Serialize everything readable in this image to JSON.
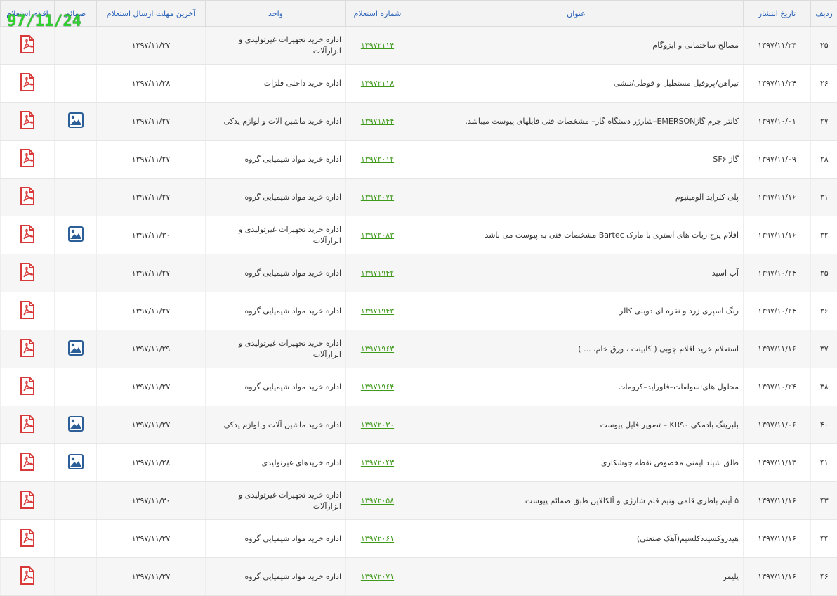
{
  "stamp_text": "97/11/24",
  "headers": {
    "index": "ردیف",
    "publish_date": "تاریخ انتشار",
    "title": "عنوان",
    "inquiry_number": "شماره استعلام",
    "unit": "واحد",
    "deadline": "آخرین مهلت ارسال استعلام",
    "attachments": "ضمائم",
    "inquiry_items": "اقلام استعلام"
  },
  "rows": [
    {
      "index": "۲۵",
      "date": "۱۳۹۷/۱۱/۲۳",
      "title": "مصالح ساختمانی و ایزوگام",
      "number": "۱۳۹۷۲۱۱۴",
      "unit": "اداره خرید تجهیزات غیرتولیدی و ابزارآلات",
      "deadline": "۱۳۹۷/۱۱/۲۷",
      "has_attachment": false
    },
    {
      "index": "۲۶",
      "date": "۱۳۹۷/۱۱/۲۴",
      "title": "تیرآهن/پروفیل مستطیل و قوطی/نبشی",
      "number": "۱۳۹۷۲۱۱۸",
      "unit": "اداره خرید داخلی فلزات",
      "deadline": "۱۳۹۷/۱۱/۲۸",
      "has_attachment": false
    },
    {
      "index": "۲۷",
      "date": "۱۳۹۷/۱۰/۰۱",
      "title": "کانتر جرم گازEMERSON–شارژر دستگاه گاز– مشخصات فنی فایلهای پیوست میباشد.",
      "number": "۱۳۹۷۱۸۴۴",
      "unit": "اداره خرید ماشین آلات و لوازم یدکی",
      "deadline": "۱۳۹۷/۱۱/۲۷",
      "has_attachment": true
    },
    {
      "index": "۲۸",
      "date": "۱۳۹۷/۱۱/۰۹",
      "title": "گاز SF۶",
      "number": "۱۳۹۷۲۰۱۲",
      "unit": "اداره خرید مواد شیمیایی گروه",
      "deadline": "۱۳۹۷/۱۱/۲۷",
      "has_attachment": false
    },
    {
      "index": "۳۱",
      "date": "۱۳۹۷/۱۱/۱۶",
      "title": "پلی کلراید آلومینیوم",
      "number": "۱۳۹۷۲۰۷۲",
      "unit": "اداره خرید مواد شیمیایی گروه",
      "deadline": "۱۳۹۷/۱۱/۲۷",
      "has_attachment": false
    },
    {
      "index": "۳۲",
      "date": "۱۳۹۷/۱۱/۱۶",
      "title": "اقلام یرج ربات های آستری با مارک Bartec مشخصات فنی به پیوست می باشد",
      "number": "۱۳۹۷۲۰۸۳",
      "unit": "اداره خرید تجهیزات غیرتولیدی و ابزارآلات",
      "deadline": "۱۳۹۷/۱۱/۳۰",
      "has_attachment": true
    },
    {
      "index": "۳۵",
      "date": "۱۳۹۷/۱۰/۲۴",
      "title": "آب اسید",
      "number": "۱۳۹۷۱۹۴۲",
      "unit": "اداره خرید مواد شیمیایی گروه",
      "deadline": "۱۳۹۷/۱۱/۲۷",
      "has_attachment": false
    },
    {
      "index": "۳۶",
      "date": "۱۳۹۷/۱۰/۲۴",
      "title": "رنگ اسپری زرد و نقره ای دوبلی کالر",
      "number": "۱۳۹۷۱۹۴۳",
      "unit": "اداره خرید مواد شیمیایی گروه",
      "deadline": "۱۳۹۷/۱۱/۲۷",
      "has_attachment": false
    },
    {
      "index": "۳۷",
      "date": "۱۳۹۷/۱۱/۱۶",
      "title": "استعلام خرید اقلام چوبی ( کابینت ، ورق خام، ... )",
      "number": "۱۳۹۷۱۹۶۳",
      "unit": "اداره خرید تجهیزات غیرتولیدی و ابزارآلات",
      "deadline": "۱۳۹۷/۱۱/۲۹",
      "has_attachment": true
    },
    {
      "index": "۳۸",
      "date": "۱۳۹۷/۱۰/۲۴",
      "title": "محلول های:سولفات–فلوراید–کرومات",
      "number": "۱۳۹۷۱۹۶۴",
      "unit": "اداره خرید مواد شیمیایی گروه",
      "deadline": "۱۳۹۷/۱۱/۲۷",
      "has_attachment": false
    },
    {
      "index": "۴۰",
      "date": "۱۳۹۷/۱۱/۰۶",
      "title": "بلبرینگ بادمکی KR۹۰ – تصویر فایل پیوست",
      "number": "۱۳۹۷۲۰۳۰",
      "unit": "اداره خرید ماشین آلات و لوازم یدکی",
      "deadline": "۱۳۹۷/۱۱/۲۷",
      "has_attachment": true
    },
    {
      "index": "۴۱",
      "date": "۱۳۹۷/۱۱/۱۳",
      "title": "طلق شیلد ایمنی مخصوص نقطه جوشکاری",
      "number": "۱۳۹۷۲۰۴۳",
      "unit": "اداره خریدهای غیرتولیدی",
      "deadline": "۱۳۹۷/۱۱/۲۸",
      "has_attachment": true
    },
    {
      "index": "۴۳",
      "date": "۱۳۹۷/۱۱/۱۶",
      "title": "۵ آیتم باطری قلمی ونیم قلم شارژی و آلکالاین طبق ضمائم پیوست",
      "number": "۱۳۹۷۲۰۵۸",
      "unit": "اداره خرید تجهیزات غیرتولیدی و ابزارآلات",
      "deadline": "۱۳۹۷/۱۱/۳۰",
      "has_attachment": false
    },
    {
      "index": "۴۴",
      "date": "۱۳۹۷/۱۱/۱۶",
      "title": "هیدروکسیددکلسیم(آهک صنعتی)",
      "number": "۱۳۹۷۲۰۶۱",
      "unit": "اداره خرید مواد شیمیایی گروه",
      "deadline": "۱۳۹۷/۱۱/۲۷",
      "has_attachment": false
    },
    {
      "index": "۴۶",
      "date": "۱۳۹۷/۱۱/۱۶",
      "title": "پلیمر",
      "number": "۱۳۹۷۲۰۷۱",
      "unit": "اداره خرید مواد شیمیایی گروه",
      "deadline": "۱۳۹۷/۱۱/۲۷",
      "has_attachment": false
    }
  ]
}
